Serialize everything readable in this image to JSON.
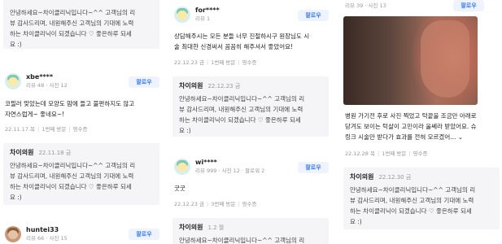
{
  "col1": {
    "top_reply_text_lines": [
      "안녕하세요~차이클리닉입니다~^^ 고객님의 리",
      "뷰 감사드리며, 내원해주신 고객님의 기대에 노력",
      "하는 차이클리닉이 되겠습니다 ♡ 좋은하루 되세",
      "요 :)"
    ],
    "review2": {
      "user": "xbe****",
      "meta": "리뷰 48 · 사진 12",
      "follow": "팔로우",
      "text_lines": [
        "코필러 맞았는데 모양도 맘에 들고 불편하지도 않고",
        "자연스럽게~ 좋네요~!"
      ],
      "date": "22.11.17.목",
      "visits": "1번째 방문",
      "receipt": "영수증"
    },
    "reply2": {
      "author": "차이의원",
      "date": "22.11.18 금",
      "text_lines": [
        "안녕하세요~차이클리닉입니다~^^ 고객님의 리",
        "뷰 감사드리며, 내원해주신 고객님의 기대에 노력",
        "하는 차이클리닉이 되겠습니다 ♡ 좋은하루 되세",
        "요 :)"
      ]
    },
    "review3": {
      "user": "huntei33",
      "meta": "리뷰 66 · 사진 15",
      "follow": "팔로우"
    }
  },
  "col2": {
    "review1": {
      "user": "for****",
      "meta": "리뷰 1",
      "follow": "팔로우",
      "text_lines": [
        "상담해주시는 모든 분들 너무 진절하시구 원장님도 시",
        "술 최대한 신경써서 꼼꼼히 해주셔서 좋았어요!"
      ],
      "date": "22.12.23 금",
      "visits": "1번째 방문",
      "receipt": "영수증"
    },
    "reply1": {
      "author": "차이의원",
      "date": "22.12.23 금",
      "text_lines": [
        "안녕하세요~차이클리닉입니다~^^ 고객님의 리",
        "뷰 감사드리며, 내원해주신 고객님의 기대에 노력",
        "하는 차이클리닉이 되겠습니다 ♡ 좋은하루 되세",
        "요 :)"
      ]
    },
    "review2": {
      "user": "wi****",
      "meta": "리뷰 999 · 사진 12 · 팔로워 2",
      "follow": "팔로우",
      "text": "굿굿",
      "date": "22.12.23 금",
      "visits": "3번째 방문",
      "receipt": "영수증"
    },
    "reply2": {
      "author": "차이의원",
      "date": "1.2 월",
      "text_lines": [
        "안녕하세요~차이클리닉입니다~^^ 고객님의 리"
      ]
    }
  },
  "col3": {
    "top_meta": "리뷰 39 · 사진 13",
    "follow": "팔로우",
    "review_text_lines": [
      "병원 가기전 후로 사진 찍었고 턱끝을 조금만 아래로",
      "당겨도 보이는 턱살이 고민이라 울쎄라 받았어요. 슈",
      "링크 시술만 받다가 효과를 전혀 모르겠어... ⌄"
    ],
    "date": "22.12.28 목",
    "visits": "1번째 방문",
    "receipt": "영수증",
    "reply": {
      "author": "차이의원",
      "date": "22.12.30 금",
      "text_lines": [
        "안녕하세요~차이클리닉입니다~^^ 고객님의 리",
        "뷰 감사드리며, 내원해주신 고객님의 기대에 노력",
        "하는 차이클리닉이 되겠습니다 ♡ 좋은하루 되세",
        "요 :)"
      ]
    }
  }
}
